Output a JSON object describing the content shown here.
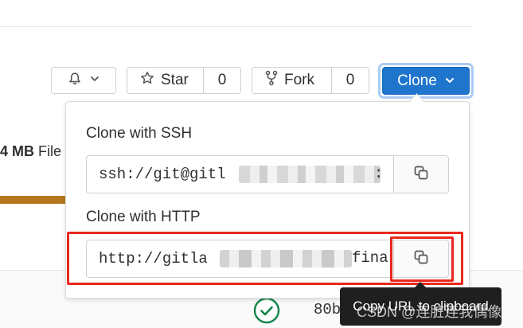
{
  "header": {
    "notify_label": "",
    "star_label": "Star",
    "star_count": "0",
    "fork_label": "Fork",
    "fork_count": "0",
    "clone_label": "Clone"
  },
  "repo_stats": {
    "size_value": "4 MB",
    "size_label": "File",
    "progress_fraction": 1.0
  },
  "clone_dropdown": {
    "ssh_title": "Clone with SSH",
    "ssh_url": "ssh://git@gitl",
    "ssh_url_tail": ":",
    "http_title": "Clone with HTTP",
    "http_url": "http://gitla",
    "http_url_tail": "fina"
  },
  "tooltip": {
    "text": "Copy URL to clipboard"
  },
  "commit": {
    "sha": "80b"
  },
  "watermark": "CSDN @连脏连我偶像",
  "colors": {
    "primary": "#1f75cb",
    "annotation_red": "#e8281d",
    "progress": "#b5761e",
    "success": "#108548"
  },
  "icons": {
    "notify": "bell-icon",
    "star": "star-icon",
    "fork": "fork-icon",
    "clone_chevron": "chevron-down-icon",
    "copy": "copy-icon",
    "pipeline": "check-circle-icon"
  }
}
